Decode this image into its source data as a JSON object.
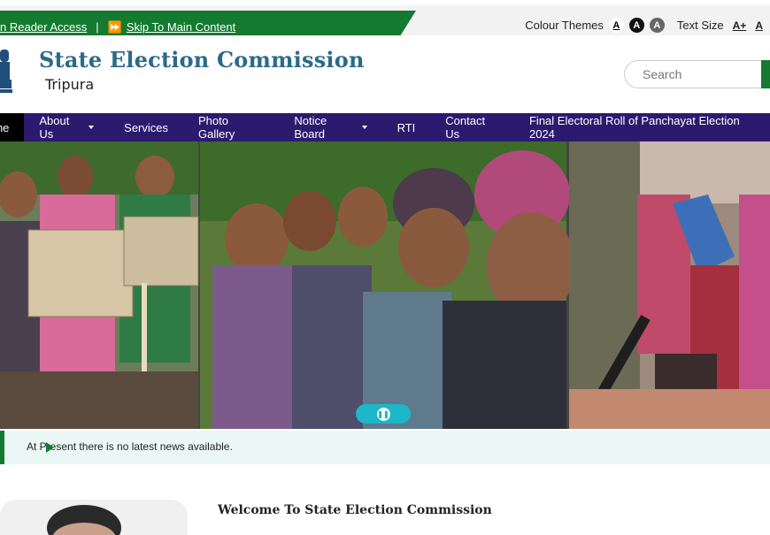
{
  "topbar": {
    "screen_reader": "n Reader Access",
    "separator": "|",
    "skip_link": "Skip To Main Content",
    "colour_themes": "Colour Themes",
    "theme_a1": "A",
    "theme_a2": "A",
    "theme_a3": "A",
    "text_size": "Text Size",
    "text_inc": "A+",
    "text_normal": "A"
  },
  "header": {
    "title": "State Election Commission",
    "subtitle": "Tripura",
    "search_placeholder": "Search"
  },
  "nav": {
    "items": [
      "me",
      "About Us",
      "Services",
      "Photo Gallery",
      "Notice Board",
      "RTI",
      "Contact Us",
      "Final Electoral Roll of Panchayat Election 2024"
    ]
  },
  "news": {
    "text": "At Present there is no latest news available."
  },
  "welcome": {
    "title": "Welcome To State Election Commission"
  },
  "colors": {
    "green": "#137a2f",
    "nav_bg": "#2b1a6e",
    "brand_blue": "#2b6a8a",
    "pause_btn": "#1cb7c9"
  }
}
